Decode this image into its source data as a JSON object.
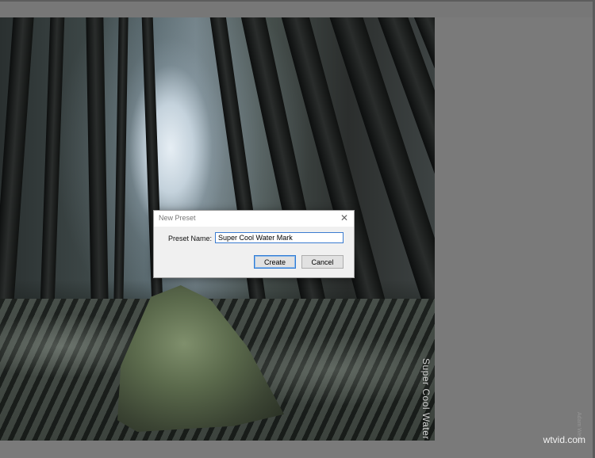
{
  "photo": {
    "watermark_text": "Super Cool Water",
    "faint_credit": "Adam Welch"
  },
  "dialog": {
    "title": "New Preset",
    "close_glyph": "✕",
    "name_label": "Preset Name:",
    "name_value": "Super Cool Water Mark",
    "create_label": "Create",
    "cancel_label": "Cancel"
  },
  "site_credit": "wtvid.com"
}
